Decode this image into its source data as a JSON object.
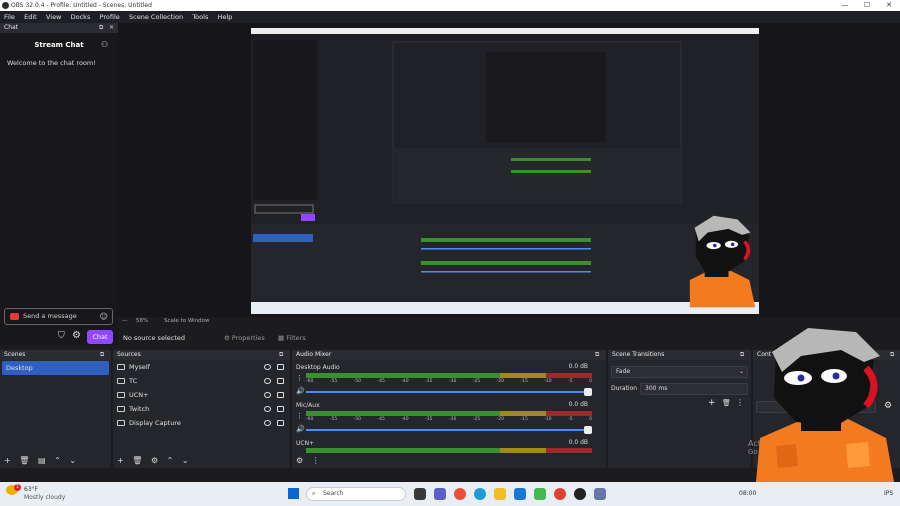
{
  "window": {
    "title": "OBS 32.0.4 - Profile: Untitled - Scenes: Untitled",
    "minimize": "—",
    "maximize": "☐",
    "close": "✕"
  },
  "menu": [
    "File",
    "Edit",
    "View",
    "Docks",
    "Profile",
    "Scene Collection",
    "Tools",
    "Help"
  ],
  "chat": {
    "dock_title": "Chat",
    "title": "Stream Chat",
    "welcome": "Welcome to the chat room!",
    "placeholder": "Send a message",
    "chat_button": "Chat"
  },
  "preview": {
    "zoom": "58%",
    "scale_mode": "Scale to Window"
  },
  "context_bar": {
    "status": "No source selected",
    "properties": "Properties",
    "filters": "Filters"
  },
  "scenes": {
    "title": "Scenes",
    "items": [
      "Desktop"
    ]
  },
  "sources": {
    "title": "Sources",
    "items": [
      "Myself",
      "TC",
      "UCN+",
      "Twitch",
      "Display Capture"
    ]
  },
  "mixer": {
    "title": "Audio Mixer",
    "ticks": [
      "-60",
      "-55",
      "-50",
      "-45",
      "-40",
      "-35",
      "-30",
      "-25",
      "-20",
      "-15",
      "-10",
      "-5",
      "0"
    ],
    "tracks": [
      {
        "name": "Desktop Audio",
        "db": "0.0 dB"
      },
      {
        "name": "Mic/Aux",
        "db": "0.0 dB"
      },
      {
        "name": "UCN+",
        "db": "0.0 dB"
      }
    ]
  },
  "transitions": {
    "title": "Scene Transitions",
    "selected": "Fade",
    "duration_label": "Duration",
    "duration_value": "300 ms"
  },
  "controls": {
    "title": "Cont",
    "camera_label": "mera"
  },
  "watermark": {
    "line1": "Activ",
    "line2": "Go"
  },
  "taskbar": {
    "weather_temp": "63°F",
    "weather_desc": "Mostly cloudy",
    "badge": "1",
    "search": "Search",
    "time": "08:00",
    "tray_label": "IPS"
  },
  "colors": {
    "accent": "#2f5fbf",
    "twitch": "#9147ff",
    "meter_green": "#3a8f2e",
    "meter_yellow": "#a08a1e",
    "meter_red": "#9c2a2a"
  }
}
